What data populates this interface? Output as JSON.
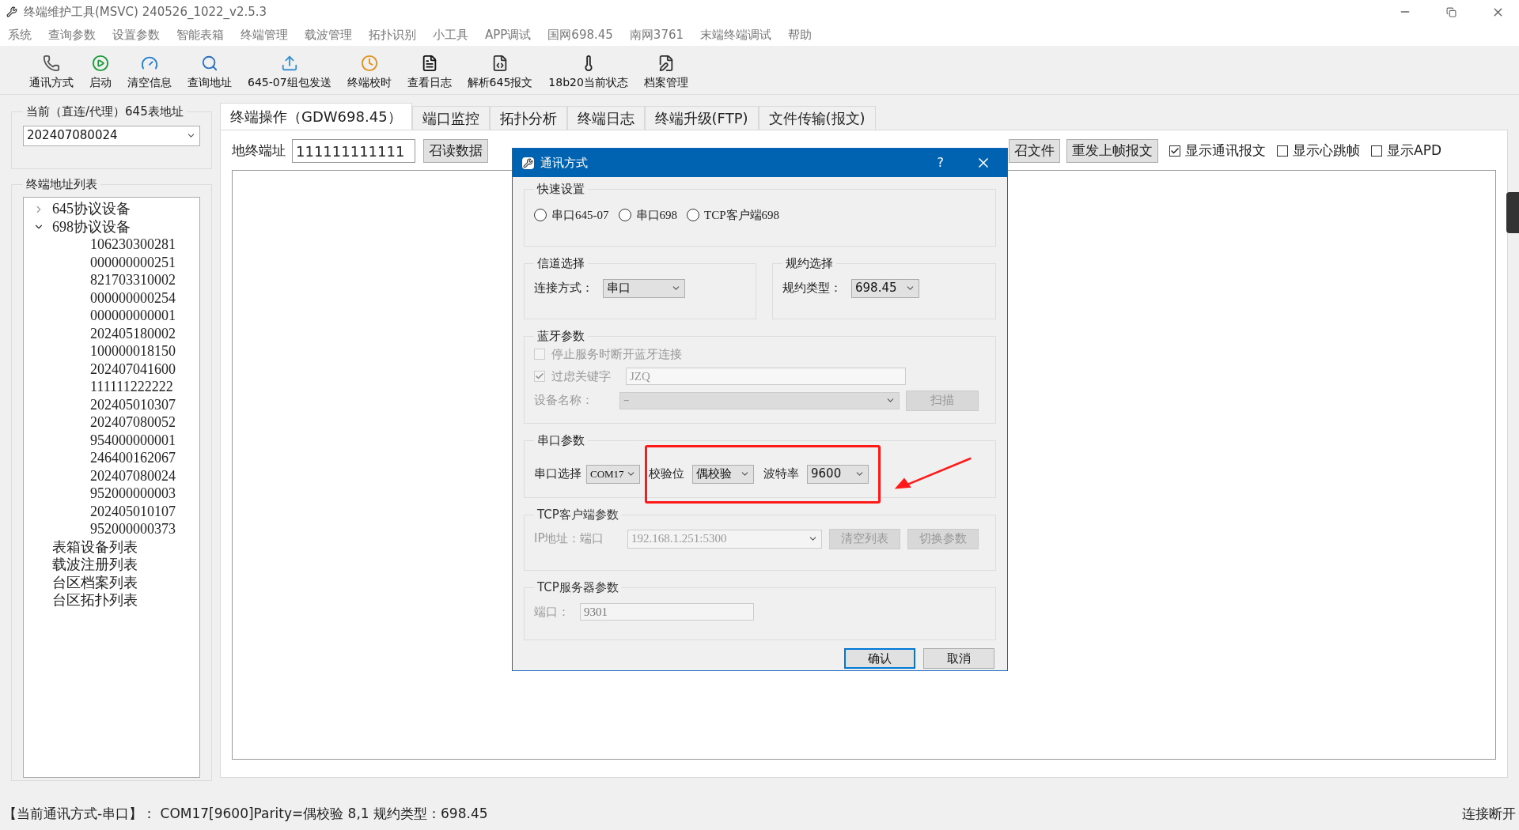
{
  "window": {
    "title": "终端维护工具(MSVC) 240526_1022_v2.5.3"
  },
  "menu": [
    "系统",
    "查询参数",
    "设置参数",
    "智能表箱",
    "终端管理",
    "载波管理",
    "拓扑识别",
    "小工具",
    "APP调试",
    "国网698.45",
    "南网3761",
    "末端终端调试",
    "帮助"
  ],
  "toolbar": [
    "通讯方式",
    "启动",
    "清空信息",
    "查询地址",
    "645-07组包发送",
    "终端校时",
    "查看日志",
    "解析645报文",
    "18b20当前状态",
    "档案管理"
  ],
  "left_panel": {
    "address_group": {
      "title": "当前（直连/代理）645表地址",
      "value": "202407080024"
    },
    "list_group": {
      "title": "终端地址列表",
      "tree": [
        {
          "label": "645协议设备",
          "expanded": false
        },
        {
          "label": "698协议设备",
          "expanded": true,
          "children": [
            {
              "label": "106230300281"
            },
            {
              "label": "000000000251"
            },
            {
              "label": "821703310002"
            },
            {
              "label": "000000000254"
            },
            {
              "label": "000000000001"
            },
            {
              "label": "202405180002"
            },
            {
              "label": "100000018150"
            },
            {
              "label": "202407041600"
            },
            {
              "label": "111111222222"
            },
            {
              "label": "202405010307"
            },
            {
              "label": "202407080052"
            },
            {
              "label": "954000000001"
            },
            {
              "label": "246400162067"
            },
            {
              "label": "202407080024"
            },
            {
              "label": "952000000003"
            },
            {
              "label": "202405010107"
            },
            {
              "label": "952000000373"
            }
          ]
        },
        {
          "label": "表箱设备列表"
        },
        {
          "label": "载波注册列表"
        },
        {
          "label": "台区档案列表"
        },
        {
          "label": "台区拓扑列表"
        }
      ]
    }
  },
  "tabs": [
    {
      "label": "终端操作（GDW698.45）",
      "selected": true
    },
    {
      "label": "端口监控",
      "selected": false
    },
    {
      "label": "拓扑分析",
      "selected": false
    },
    {
      "label": "终端日志",
      "selected": false
    },
    {
      "label": "终端升级(FTP)",
      "selected": false
    },
    {
      "label": "文件传输(报文)",
      "selected": false
    }
  ],
  "address_row": {
    "label": "地终端址",
    "value": "111111111111",
    "buttons_left": [
      "召读数据"
    ],
    "buttons_right": [
      "召文件",
      "重发上帧报文"
    ],
    "checkboxes": [
      {
        "label": "显示通讯报文",
        "checked": true
      },
      {
        "label": "显示心跳帧",
        "checked": false
      },
      {
        "label": "显示APD",
        "checked": false
      }
    ]
  },
  "dialog": {
    "title": "通讯方式",
    "help": "?",
    "quick": {
      "title": "快速设置",
      "radios": [
        {
          "label": "串口645-07",
          "selected": false
        },
        {
          "label": "串口698",
          "selected": false
        },
        {
          "label": "TCP客户端698",
          "selected": false
        }
      ]
    },
    "channel": {
      "title": "信道选择",
      "label": "连接方式：",
      "value": "串口"
    },
    "protocol": {
      "title": "规约选择",
      "label": "规约类型：",
      "value": "698.45"
    },
    "bluetooth": {
      "title": "蓝牙参数",
      "disabled": true,
      "stop_check": {
        "label": "停止服务时断开蓝牙连接",
        "checked": false
      },
      "filter_check": {
        "label": "过虑关键字",
        "checked": true
      },
      "filter_value": "JZQ",
      "device_label": "设备名称：",
      "device_value": "–",
      "scan": "扫描"
    },
    "serial": {
      "title": "串口参数",
      "port_label": "串口选择",
      "port": "COM17",
      "parity_label": "校验位",
      "parity": "偶校验",
      "baud_label": "波特率",
      "baud": "9600"
    },
    "tcp_client": {
      "title": "TCP客户端参数",
      "disabled": true,
      "label": "IP地址：端口",
      "value": "192.168.1.251:5300",
      "buttons": [
        "清空列表",
        "切换参数"
      ]
    },
    "tcp_server": {
      "title": "TCP服务器参数",
      "disabled": true,
      "label": "端口：",
      "value": "9301"
    },
    "buttons": [
      {
        "label": "确认",
        "default": true
      },
      {
        "label": "取消",
        "default": false
      }
    ]
  },
  "status_bar": {
    "text": "【当前通讯方式-串口】： COM17[9600]Parity=偶校验 8,1 规约类型：698.45",
    "right": "连接断开"
  }
}
